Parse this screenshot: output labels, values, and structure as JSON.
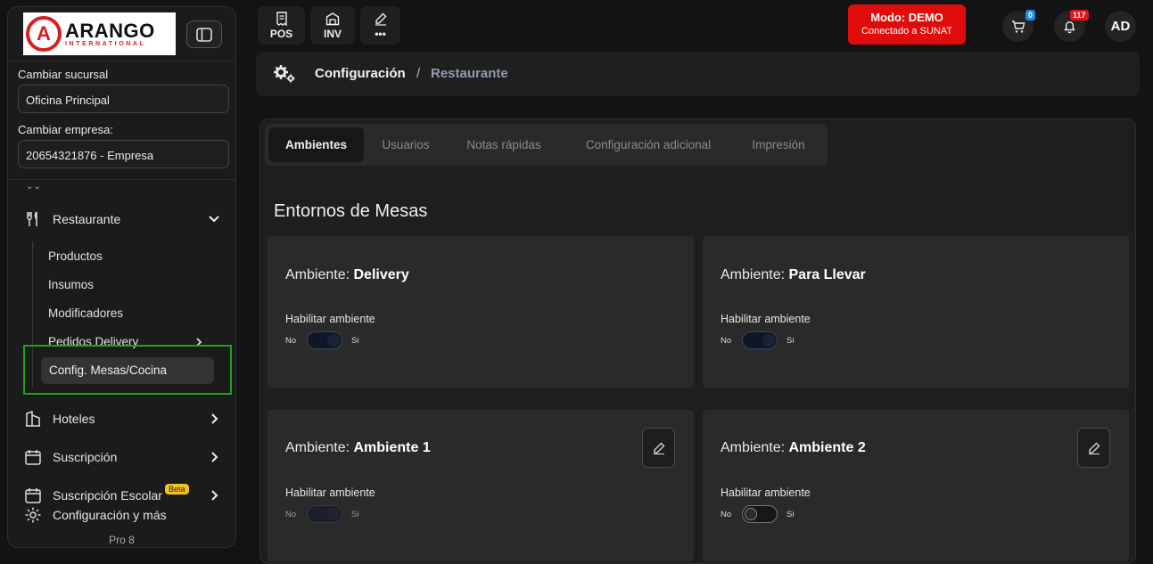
{
  "brand": {
    "logo_word": "ARANGO",
    "logo_sub": "INTERNATIONAL",
    "logo_letter": "A"
  },
  "sidebar": {
    "branch_label": "Cambiar sucursal",
    "branch_value": "Oficina Principal",
    "company_label": "Cambiar empresa:",
    "company_value": "20654321876 - Empresa",
    "items": [
      {
        "label": "Restaurante",
        "icon": "fork-knife-icon",
        "expanded": true
      },
      {
        "label": "Hoteles",
        "icon": "building-icon"
      },
      {
        "label": "Suscripción",
        "icon": "calendar-icon"
      },
      {
        "label": "Suscripción Escolar",
        "icon": "calendar-icon",
        "badge": "Beta"
      },
      {
        "label": "Configuración y más",
        "icon": "gear-icon"
      }
    ],
    "submenu": [
      "Productos",
      "Insumos",
      "Modificadores",
      "Pedidos Delivery",
      "Config. Mesas/Cocina"
    ],
    "active_submenu": "Config. Mesas/Cocina",
    "version": "Pro 8"
  },
  "topbar": {
    "buttons": [
      {
        "label": "POS",
        "icon": "receipt-icon"
      },
      {
        "label": "INV",
        "icon": "warehouse-icon"
      },
      {
        "label": "•••",
        "icon": "edit-icon"
      }
    ],
    "mode_title": "Modo: DEMO",
    "mode_sub": "Conectado a SUNAT",
    "cart_count": "0",
    "notif_count": "117",
    "avatar": "AD",
    "colors": {
      "mode_bg": "#e00b0b",
      "cart_badge": "#1a8de0",
      "notif_badge": "#e0151b"
    }
  },
  "breadcrumb": {
    "root": "Configuración",
    "sep": "/",
    "current": "Restaurante"
  },
  "tabs": [
    "Ambientes",
    "Usuarios",
    "Notas rápidas",
    "Configuración adicional",
    "Impresión"
  ],
  "active_tab": "Ambientes",
  "section_title": "Entornos de Mesas",
  "cards": [
    {
      "prefix": "Ambiente:",
      "name": "Delivery",
      "toggle_label": "Habilitar ambiente",
      "no": "No",
      "si": "Si",
      "enabled": true,
      "editable": false
    },
    {
      "prefix": "Ambiente:",
      "name": "Para Llevar",
      "toggle_label": "Habilitar ambiente",
      "no": "No",
      "si": "Si",
      "enabled": true,
      "editable": false
    },
    {
      "prefix": "Ambiente:",
      "name": "Ambiente 1",
      "toggle_label": "Habilitar ambiente",
      "no": "No",
      "si": "Si",
      "enabled": true,
      "editable": true
    },
    {
      "prefix": "Ambiente:",
      "name": "Ambiente 2",
      "toggle_label": "Habilitar ambiente",
      "no": "No",
      "si": "Si",
      "enabled": false,
      "editable": true
    }
  ]
}
